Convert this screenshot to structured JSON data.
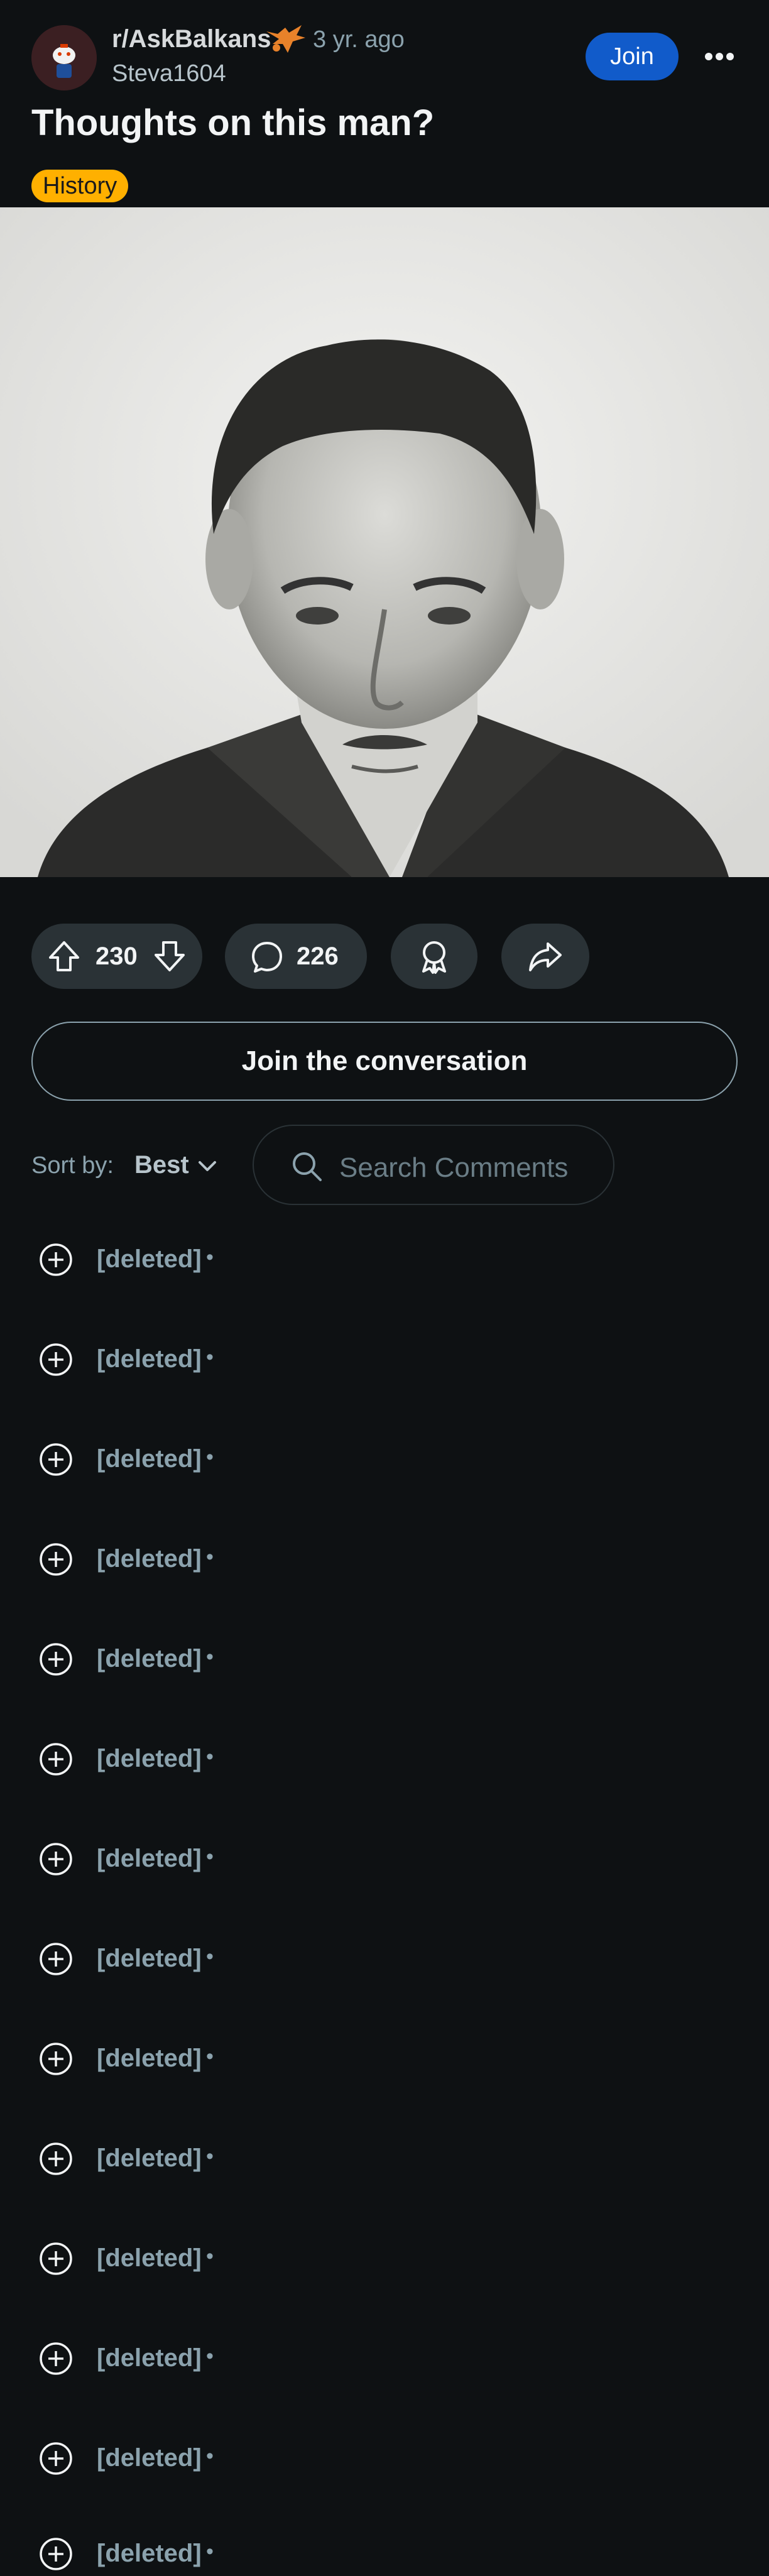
{
  "post": {
    "subreddit": "r/AskBalkans",
    "time": "3 yr. ago",
    "author": "Steva1604",
    "join_label": "Join",
    "title": "Thoughts on this man?",
    "flair": "History"
  },
  "actions": {
    "votes": "230",
    "comments": "226"
  },
  "join_conversation": "Join the conversation",
  "sort": {
    "label": "Sort by:",
    "value": "Best"
  },
  "search": {
    "placeholder": "Search Comments"
  },
  "comments": [
    {
      "author": "[deleted]",
      "dot": "•"
    },
    {
      "author": "[deleted]",
      "dot": "•"
    },
    {
      "author": "[deleted]",
      "dot": "•"
    },
    {
      "author": "[deleted]",
      "dot": "•"
    },
    {
      "author": "[deleted]",
      "dot": "•"
    },
    {
      "author": "[deleted]",
      "dot": "•"
    },
    {
      "author": "[deleted]",
      "dot": "•"
    },
    {
      "author": "[deleted]",
      "dot": "•"
    },
    {
      "author": "[deleted]",
      "dot": "•"
    },
    {
      "author": "[deleted]",
      "dot": "•"
    },
    {
      "author": "[deleted]",
      "dot": "•"
    },
    {
      "author": "[deleted]",
      "dot": "•"
    },
    {
      "author": "[deleted]",
      "dot": "•"
    },
    {
      "author": "[deleted]",
      "dot": "•"
    }
  ],
  "colors": {
    "background": "#0e1113",
    "join_button": "#115bca",
    "flair": "#ffb000",
    "pill": "#2a3236"
  },
  "icons": [
    "subreddit-avatar",
    "subreddit-emoji",
    "more-icon",
    "upvote-icon",
    "downvote-icon",
    "comment-icon",
    "award-icon",
    "share-icon",
    "chevron-down-icon",
    "search-icon",
    "expand-icon"
  ]
}
